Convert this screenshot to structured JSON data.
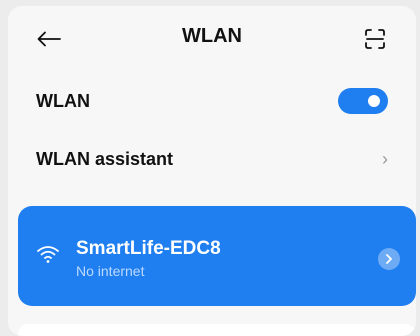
{
  "header": {
    "title": "WLAN",
    "back_icon": "arrow-left-icon",
    "scan_icon": "scan-icon"
  },
  "wlan_row": {
    "label": "WLAN",
    "toggle_on": true
  },
  "assistant_row": {
    "label": "WLAN assistant",
    "chevron": "›"
  },
  "connected_network": {
    "ssid": "SmartLife-EDC8",
    "status": "No internet",
    "signal_icon": "wifi-icon",
    "detail_icon": "chevron-right-icon"
  },
  "colors": {
    "accent": "#1f7ff0",
    "background": "#f7f7f7"
  }
}
